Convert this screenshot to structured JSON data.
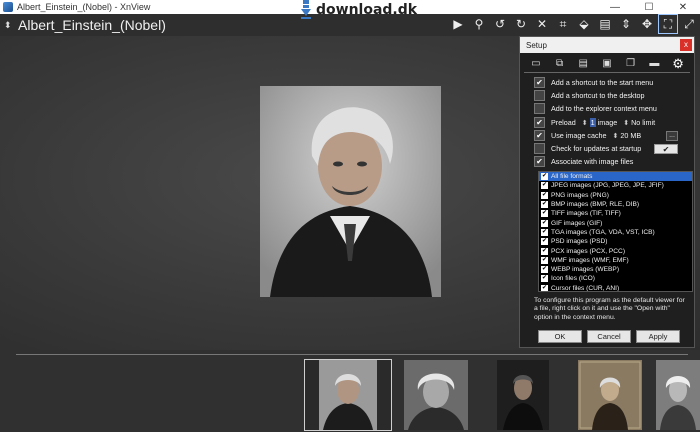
{
  "window": {
    "title": "Albert_Einstein_(Nobel) - XnView",
    "min_glyph": "—",
    "max_glyph": "☐",
    "close_glyph": "✕"
  },
  "watermark": {
    "text": "download.dk"
  },
  "viewer": {
    "sort_glyph": "⬍",
    "image_title": "Albert_Einstein_(Nobel)"
  },
  "toolbar": {
    "icons": [
      "play-icon",
      "search-icon",
      "rotate-left-icon",
      "rotate-right-icon",
      "close-x-icon",
      "crop-icon",
      "eraser-icon",
      "document-icon",
      "resize-icon",
      "move-icon",
      "fit-icon",
      "fullscreen-icon"
    ],
    "glyphs": {
      "play": "▶",
      "search": "⚲",
      "rotate_left": "↺",
      "rotate_right": "↻",
      "close_x": "✕",
      "crop": "⌗",
      "eraser": "⬙",
      "doc": "▤",
      "resize": "⇕",
      "move": "✥",
      "fit": "⛶",
      "fullscreen": "⤢"
    }
  },
  "setup": {
    "title": "Setup",
    "close_glyph": "x",
    "tab_glyphs": [
      "▭",
      "⧉",
      "▤",
      "▣",
      "❐",
      "▬",
      "⚙"
    ],
    "options": {
      "start_menu": "Add a shortcut to the start menu",
      "desktop": "Add a shortcut to the desktop",
      "context_menu": "Add to the explorer context menu",
      "preload": "Preload",
      "preload_count": "1",
      "preload_unit": "image",
      "no_limit": "No limit",
      "image_cache": "Use image cache",
      "cache_size": "20 MB",
      "browse_label": "...",
      "check_updates": "Check for updates at startup",
      "check_btn": "✔",
      "associate": "Associate with image files"
    },
    "checks": {
      "start_menu": "✔",
      "desktop": "",
      "context_menu": "",
      "preload": "✔",
      "image_cache": "✔",
      "check_updates": "",
      "associate": "✔"
    },
    "spin_glyph": "⬍",
    "formats": [
      "All file formats",
      "JPEG images (JPG, JPEG, JPE, JFIF)",
      "PNG images (PNG)",
      "BMP images (BMP, RLE, DIB)",
      "TIFF images (TIF, TIFF)",
      "GIF images (GIF)",
      "TGA images (TGA, VDA, VST, ICB)",
      "PSD images (PSD)",
      "PCX images (PCX, PCC)",
      "WMF images (WMF, EMF)",
      "WEBP images (WEBP)",
      "Icon files (ICO)",
      "Cursor files (CUR, ANI)"
    ],
    "format_check": "✔",
    "info": "To configure this program as the default viewer for a file, right click on it and use the \"Open with\" option in the context menu.",
    "ok": "OK",
    "cancel": "Cancel",
    "apply": "Apply"
  },
  "thumbnails": {
    "count": 5,
    "selected_index": 0
  }
}
